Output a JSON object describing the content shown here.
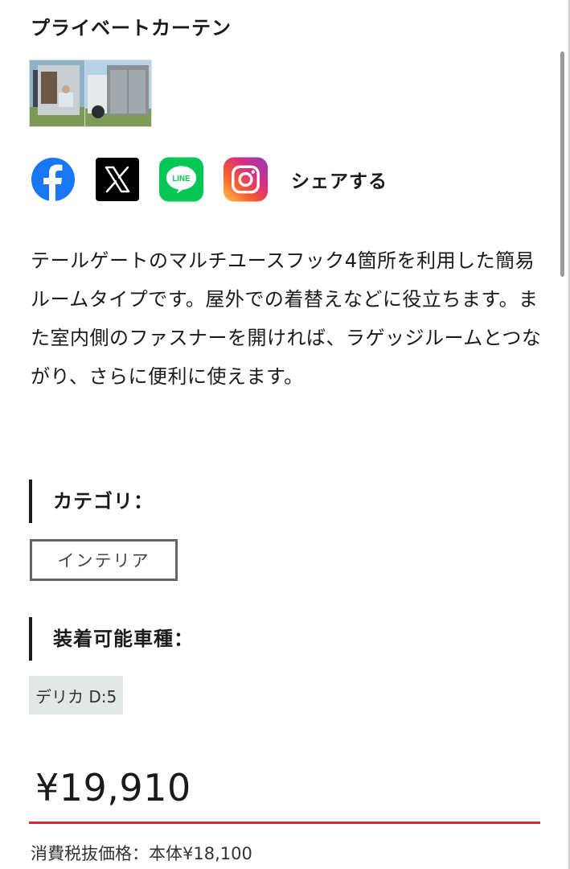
{
  "product": {
    "title": "プライベートカーテン",
    "description": "テールゲートのマルチユースフック4箇所を利用した簡易ルームタイプです。屋外での着替えなどに役立ちます。また室内側のファスナーを開ければ、ラゲッジルームとつながり、さらに便利に使えます。"
  },
  "share": {
    "label": "シェアする",
    "icons": [
      "facebook-icon",
      "x-icon",
      "line-icon",
      "instagram-icon"
    ],
    "line_text": "LINE"
  },
  "category": {
    "heading": "カテゴリ：",
    "tag": "インテリア"
  },
  "compatible": {
    "heading": "装着可能車種：",
    "tag": "デリカ D:5"
  },
  "pricing": {
    "price": "¥19,910",
    "tax_note": "消費税抜価格：本体¥18,100"
  },
  "colors": {
    "accent_red": "#d9272e",
    "facebook": "#1877f2",
    "line": "#06c755",
    "tag_bg": "#e3e7e6"
  }
}
